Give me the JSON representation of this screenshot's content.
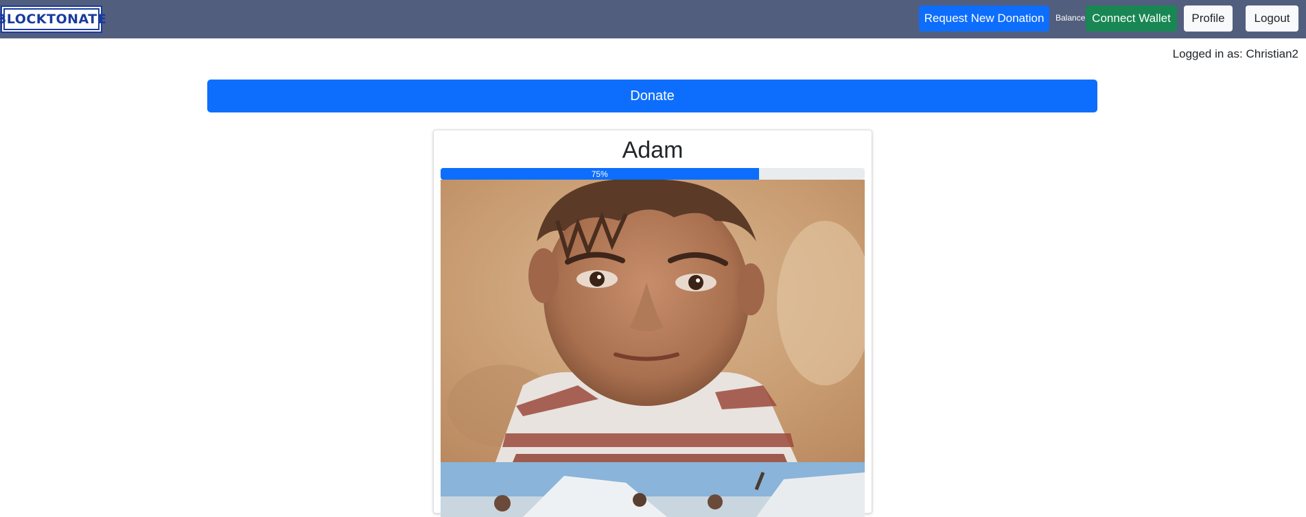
{
  "header": {
    "logo_text": "BLOCKTONATE",
    "request_label": "Request New Donation",
    "balance_label": "Balance:",
    "wallet_label": "Connect Wallet",
    "profile_label": "Profile",
    "logout_label": "Logout"
  },
  "user": {
    "logged_in_text": "Logged in as: Christian2"
  },
  "main": {
    "donate_label": "Donate"
  },
  "card": {
    "name": "Adam",
    "progress_label": "75%",
    "progress_value": 75
  },
  "colors": {
    "navbar": "#525e7d",
    "primary": "#0d6efd",
    "success": "#198754",
    "light": "#f8f9fa"
  }
}
